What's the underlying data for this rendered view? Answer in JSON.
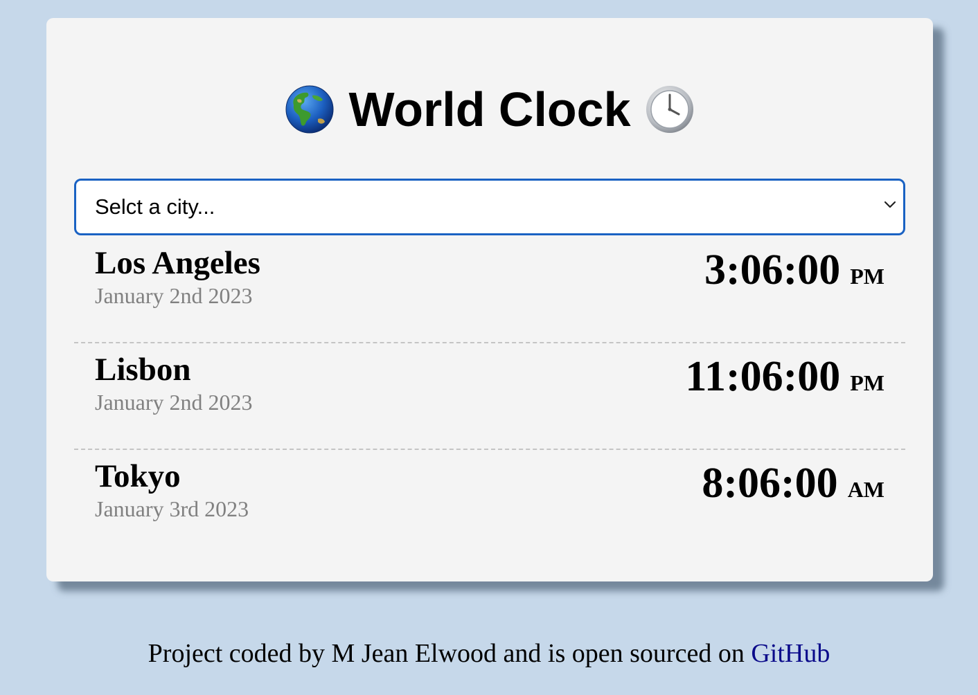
{
  "header": {
    "title": "World Clock",
    "left_icon": "globe-americas-icon",
    "right_icon": "clock-icon"
  },
  "city_select": {
    "selected_text": "Selct a city..."
  },
  "cities": [
    {
      "name": "Los Angeles",
      "date": "January 2nd 2023",
      "time": "3:06:00",
      "ampm": "PM"
    },
    {
      "name": "Lisbon",
      "date": "January 2nd 2023",
      "time": "11:06:00",
      "ampm": "PM"
    },
    {
      "name": "Tokyo",
      "date": "January 3rd 2023",
      "time": "8:06:00",
      "ampm": "AM"
    }
  ],
  "footer": {
    "text": "Project coded by M Jean Elwood and is open sourced on ",
    "link_text": "GitHub"
  },
  "colors": {
    "background": "#c6d8ea",
    "card": "#f4f4f4",
    "select_border": "#1a62c3",
    "date_text": "#808080",
    "link": "#0a0a8a"
  }
}
